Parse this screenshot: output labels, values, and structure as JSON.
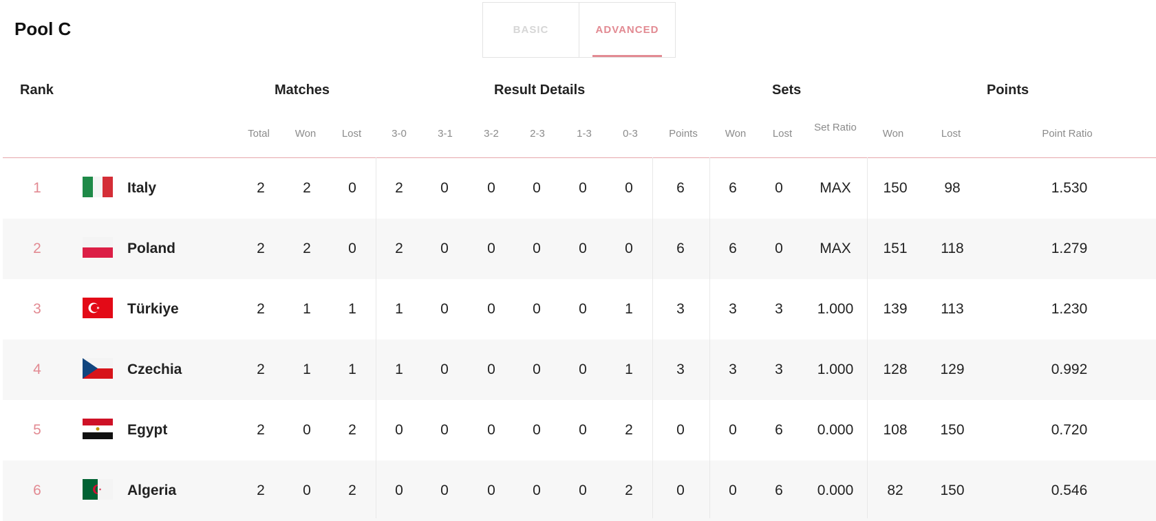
{
  "pool_title": "Pool C",
  "tabs": {
    "basic": "BASIC",
    "advanced": "ADVANCED"
  },
  "group_headers": {
    "rank": "Rank",
    "matches": "Matches",
    "result_details": "Result Details",
    "sets": "Sets",
    "points": "Points"
  },
  "sub_headers": {
    "total": "Total",
    "won": "Won",
    "lost": "Lost",
    "r30": "3-0",
    "r31": "3-1",
    "r32": "3-2",
    "r23": "2-3",
    "r13": "1-3",
    "r03": "0-3",
    "points": "Points",
    "sets_won": "Won",
    "sets_lost": "Lost",
    "set_ratio": "Set Ratio",
    "points_won": "Won",
    "points_lost": "Lost",
    "point_ratio": "Point Ratio"
  },
  "rows": [
    {
      "rank": "1",
      "team": "Italy",
      "flag": "italy-flag-icon",
      "total": "2",
      "won": "2",
      "lost": "0",
      "r30": "2",
      "r31": "0",
      "r32": "0",
      "r23": "0",
      "r13": "0",
      "r03": "0",
      "points": "6",
      "sets_won": "6",
      "sets_lost": "0",
      "set_ratio": "MAX",
      "pts_won": "150",
      "pts_lost": "98",
      "point_ratio": "1.530"
    },
    {
      "rank": "2",
      "team": "Poland",
      "flag": "poland-flag-icon",
      "total": "2",
      "won": "2",
      "lost": "0",
      "r30": "2",
      "r31": "0",
      "r32": "0",
      "r23": "0",
      "r13": "0",
      "r03": "0",
      "points": "6",
      "sets_won": "6",
      "sets_lost": "0",
      "set_ratio": "MAX",
      "pts_won": "151",
      "pts_lost": "118",
      "point_ratio": "1.279"
    },
    {
      "rank": "3",
      "team": "Türkiye",
      "flag": "turkiye-flag-icon",
      "total": "2",
      "won": "1",
      "lost": "1",
      "r30": "1",
      "r31": "0",
      "r32": "0",
      "r23": "0",
      "r13": "0",
      "r03": "1",
      "points": "3",
      "sets_won": "3",
      "sets_lost": "3",
      "set_ratio": "1.000",
      "pts_won": "139",
      "pts_lost": "113",
      "point_ratio": "1.230"
    },
    {
      "rank": "4",
      "team": "Czechia",
      "flag": "czechia-flag-icon",
      "total": "2",
      "won": "1",
      "lost": "1",
      "r30": "1",
      "r31": "0",
      "r32": "0",
      "r23": "0",
      "r13": "0",
      "r03": "1",
      "points": "3",
      "sets_won": "3",
      "sets_lost": "3",
      "set_ratio": "1.000",
      "pts_won": "128",
      "pts_lost": "129",
      "point_ratio": "0.992"
    },
    {
      "rank": "5",
      "team": "Egypt",
      "flag": "egypt-flag-icon",
      "total": "2",
      "won": "0",
      "lost": "2",
      "r30": "0",
      "r31": "0",
      "r32": "0",
      "r23": "0",
      "r13": "0",
      "r03": "2",
      "points": "0",
      "sets_won": "0",
      "sets_lost": "6",
      "set_ratio": "0.000",
      "pts_won": "108",
      "pts_lost": "150",
      "point_ratio": "0.720"
    },
    {
      "rank": "6",
      "team": "Algeria",
      "flag": "algeria-flag-icon",
      "total": "2",
      "won": "0",
      "lost": "2",
      "r30": "0",
      "r31": "0",
      "r32": "0",
      "r23": "0",
      "r13": "0",
      "r03": "2",
      "points": "0",
      "sets_won": "0",
      "sets_lost": "6",
      "set_ratio": "0.000",
      "pts_won": "82",
      "pts_lost": "150",
      "point_ratio": "0.546"
    }
  ],
  "colors": {
    "accent": "#e28a92",
    "row_alt": "#f7f7f7",
    "divider": "#e6a6ab"
  }
}
